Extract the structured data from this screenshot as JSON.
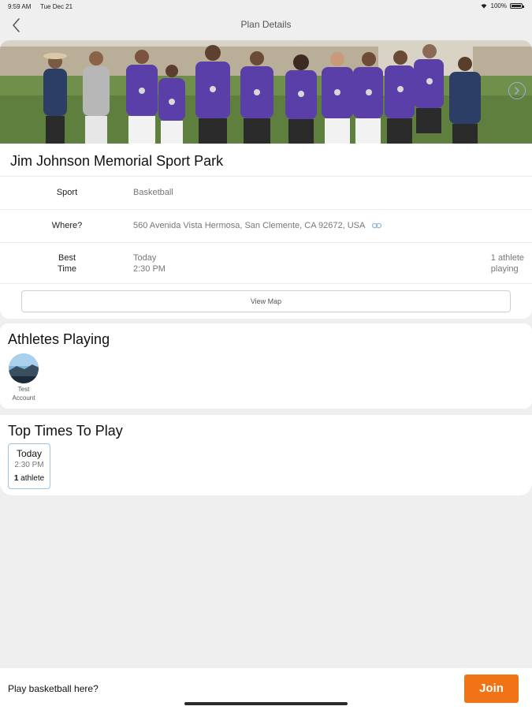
{
  "status_bar": {
    "time": "9:59 AM",
    "date": "Tue Dec 21",
    "battery": "100%"
  },
  "nav": {
    "title": "Plan Details"
  },
  "plan": {
    "park_name": "Jim Johnson Memorial Sport Park",
    "sport_label": "Sport",
    "sport_value": "Basketball",
    "where_label": "Where?",
    "where_value": "560 Avenida Vista Hermosa, San Clemente, CA 92672, USA",
    "best_time_label_line1": "Best",
    "best_time_label_line2": "Time",
    "best_time_day": "Today",
    "best_time_time": "2:30 PM",
    "best_time_count_line1": "1 athlete",
    "best_time_count_line2": "playing",
    "view_map_label": "View Map"
  },
  "athletes": {
    "title": "Athletes Playing",
    "items": [
      {
        "name_line1": "Test",
        "name_line2": "Account"
      }
    ]
  },
  "top_times": {
    "title": "Top Times To Play",
    "items": [
      {
        "day": "Today",
        "time": "2:30 PM",
        "count_num": "1",
        "count_label": " athlete"
      }
    ]
  },
  "bottom": {
    "prompt": "Play basketball here?",
    "join_label": "Join"
  },
  "colors": {
    "accent": "#f07316",
    "chip_border": "#9cc3e8",
    "jersey": "#5b3fa8"
  },
  "icons": [
    "back-chevron-icon",
    "next-arrow-icon",
    "link-icon",
    "wifi-icon",
    "battery-icon"
  ]
}
